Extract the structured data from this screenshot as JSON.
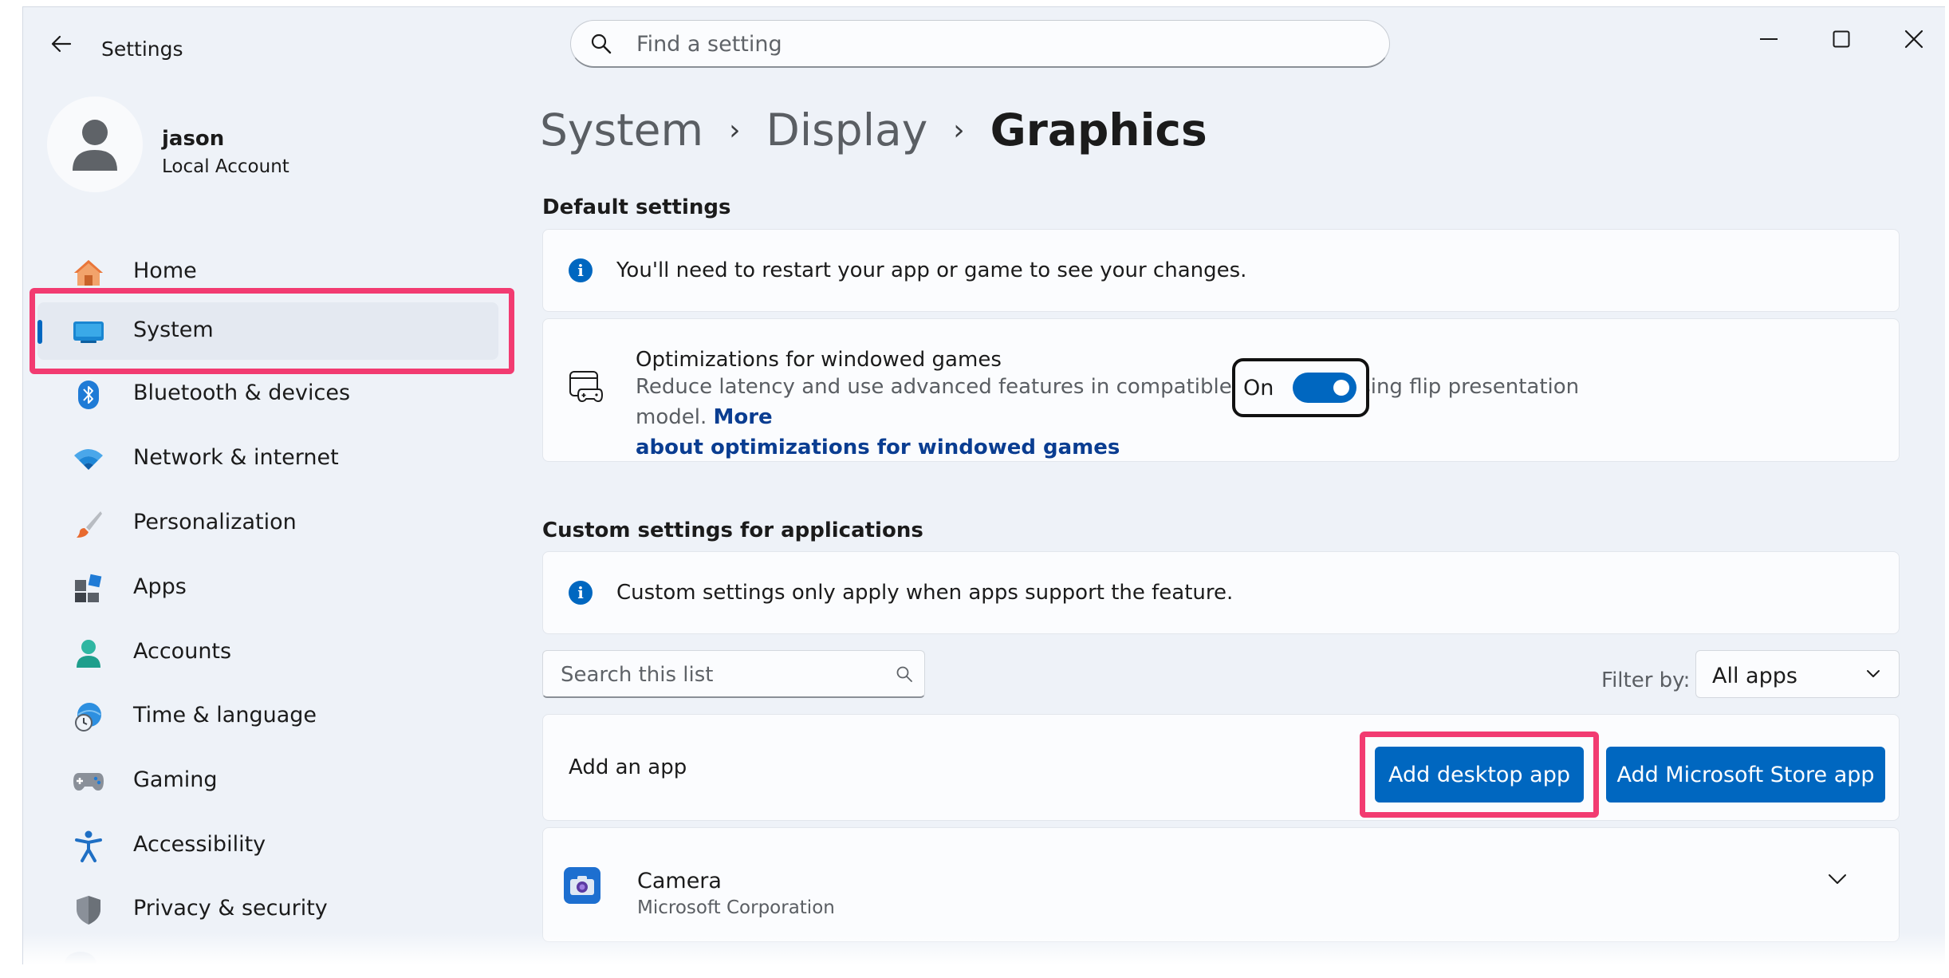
{
  "window": {
    "title": "Settings"
  },
  "search": {
    "placeholder": "Find a setting"
  },
  "profile": {
    "name": "jason",
    "account_type": "Local Account"
  },
  "sidebar": {
    "items": [
      {
        "label": "Home",
        "icon": "home-icon"
      },
      {
        "label": "System",
        "icon": "system-display-icon",
        "selected": true
      },
      {
        "label": "Bluetooth & devices",
        "icon": "bluetooth-icon"
      },
      {
        "label": "Network & internet",
        "icon": "wifi-icon"
      },
      {
        "label": "Personalization",
        "icon": "brush-icon"
      },
      {
        "label": "Apps",
        "icon": "apps-icon"
      },
      {
        "label": "Accounts",
        "icon": "person-icon"
      },
      {
        "label": "Time & language",
        "icon": "globe-clock-icon"
      },
      {
        "label": "Gaming",
        "icon": "gamepad-icon"
      },
      {
        "label": "Accessibility",
        "icon": "accessibility-icon"
      },
      {
        "label": "Privacy & security",
        "icon": "shield-icon"
      }
    ]
  },
  "breadcrumb": {
    "items": [
      "System",
      "Display",
      "Graphics"
    ]
  },
  "default_settings": {
    "title": "Default settings",
    "info_text": "You'll need to restart your app or game to see your changes.",
    "optimization": {
      "title": "Optimizations for windowed games",
      "description": "Reduce latency and use advanced features in compatible games by using flip presentation model.",
      "link_line1": "More",
      "link_line2": "about optimizations for windowed games",
      "toggle_label": "On",
      "toggle_on": true
    }
  },
  "custom_settings": {
    "title": "Custom settings for applications",
    "info_text": "Custom settings only apply when apps support the feature.",
    "list_search_placeholder": "Search this list",
    "filter_label": "Filter by:",
    "filter_value": "All apps",
    "add_app_label": "Add an app",
    "add_desktop_button": "Add desktop app",
    "add_store_button": "Add Microsoft Store app",
    "apps": [
      {
        "name": "Camera",
        "publisher": "Microsoft Corporation"
      }
    ]
  },
  "colors": {
    "accent": "#0067c0",
    "highlight": "#f23b71",
    "link": "#0a3d91",
    "window_bg": "#eef2f8",
    "card_bg": "#fbfcfe"
  }
}
